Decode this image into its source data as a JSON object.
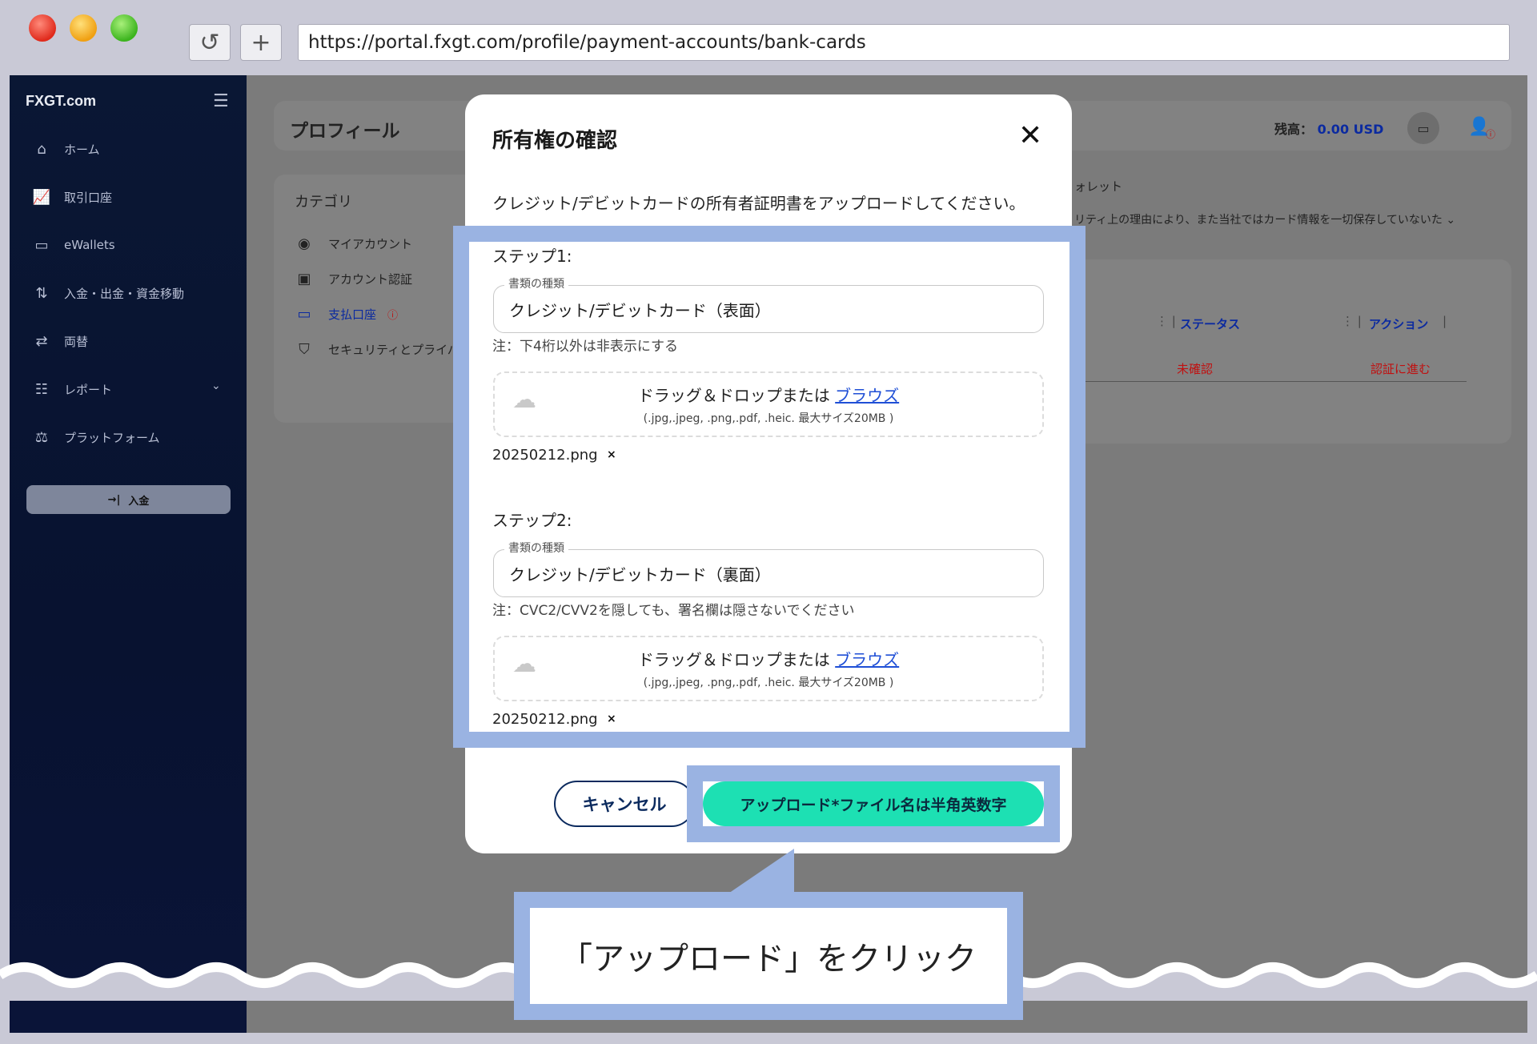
{
  "browser": {
    "url": "https://portal.fxgt.com/profile/payment-accounts/bank-cards",
    "reload_icon": "reload-icon",
    "newtab_icon": "plus-icon"
  },
  "sidebar": {
    "logo": "FXGT.com",
    "items": [
      {
        "label": "ホーム",
        "icon": "home-icon"
      },
      {
        "label": "取引口座",
        "icon": "chart-icon"
      },
      {
        "label": "eWallets",
        "icon": "wallet-icon"
      },
      {
        "label": "入金・出金・資金移動",
        "icon": "transfer-icon"
      },
      {
        "label": "両替",
        "icon": "exchange-icon"
      },
      {
        "label": "レポート",
        "icon": "report-icon"
      },
      {
        "label": "プラットフォーム",
        "icon": "platform-icon"
      }
    ],
    "deposit_button": "入金"
  },
  "page": {
    "title": "プロフィール",
    "balance_label": "残高：",
    "balance_value": "0.00 USD",
    "category_title": "カテゴリ",
    "categories": [
      {
        "label": "マイアカウント"
      },
      {
        "label": "アカウント認証"
      },
      {
        "label": "支払口座"
      },
      {
        "label": "セキュリティとプライバ"
      }
    ],
    "wallet_label": "ォレット",
    "security_note": "リティ上の理由により、また当社ではカード情報を一切保存していないた",
    "table": {
      "col_status": "ステータス",
      "col_action": "アクション",
      "status_value": "未確認",
      "action_value": "認証に進む"
    }
  },
  "modal": {
    "title": "所有権の確認",
    "description": "クレジット/デビットカードの所有者証明書をアップロードしてください。",
    "steps": [
      {
        "label": "ステップ1:",
        "field_legend": "書類の種類",
        "field_value": "クレジット/デビットカード（表面）",
        "note": "注：下4桁以外は非表示にする",
        "drop_text": "ドラッグ＆ドロップまたは",
        "browse": "ブラウズ",
        "drop_sub": "(.jpg,.jpeg, .png,.pdf, .heic. 最大サイズ20MB )",
        "file": "20250212.png"
      },
      {
        "label": "ステップ2:",
        "field_legend": "書類の種類",
        "field_value": "クレジット/デビットカード（裏面）",
        "note": "注：CVC2/CVV2を隠しても、署名欄は隠さないでください",
        "drop_text": "ドラッグ＆ドロップまたは",
        "browse": "ブラウズ",
        "drop_sub": "(.jpg,.jpeg, .png,.pdf, .heic. 最大サイズ20MB )",
        "file": "20250212.png"
      }
    ],
    "cancel_label": "キャンセル",
    "upload_label": "アップロード*ファイル名は半角英数字"
  },
  "callout": {
    "text": "「アップロード」をクリック"
  },
  "colors": {
    "highlight": "#9ab3e2",
    "upload_button": "#1de0b3",
    "accent_blue": "#0b2aa0",
    "alert_red": "#c01010"
  }
}
